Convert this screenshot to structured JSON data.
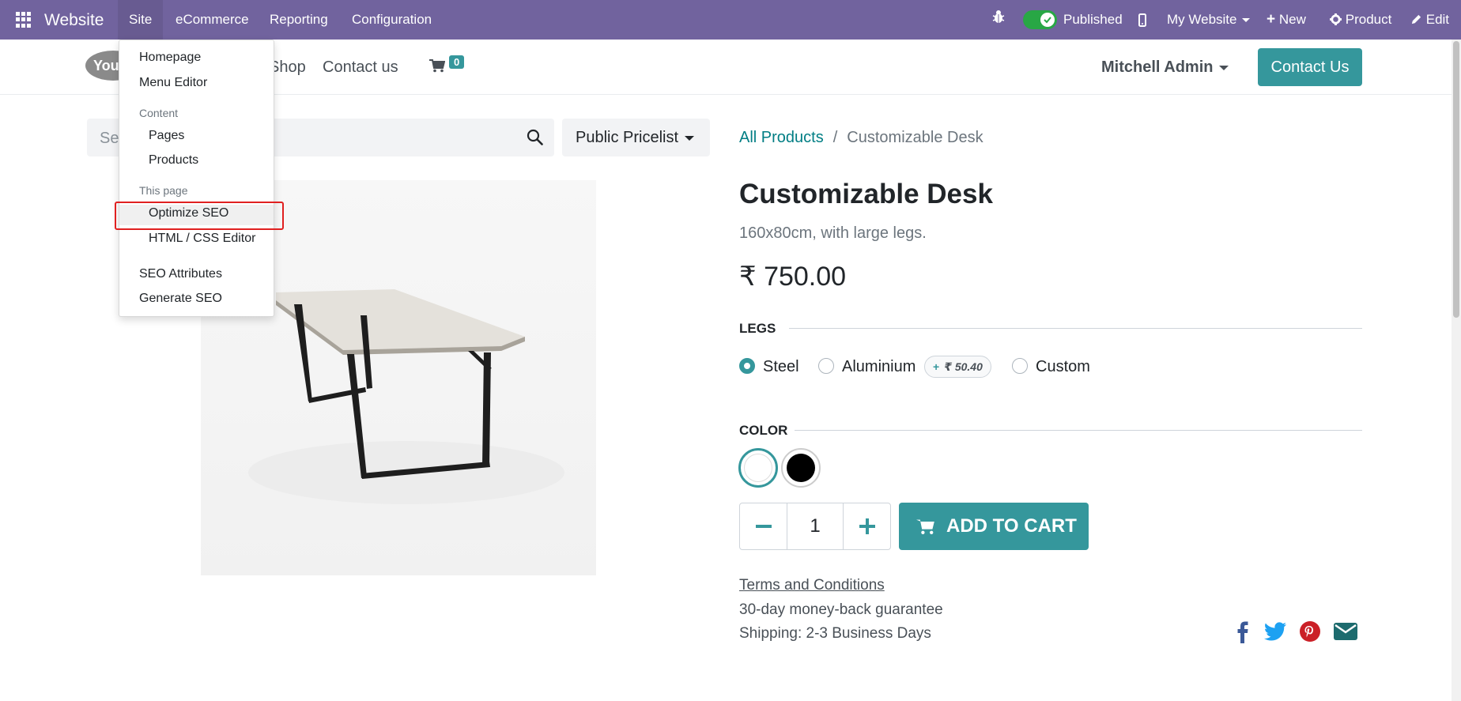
{
  "topbar": {
    "brand": "Website",
    "menus": [
      "Site",
      "eCommerce",
      "Reporting",
      "Configuration"
    ],
    "published_label": "Published",
    "website_selector": "My Website",
    "new_label": "New",
    "product_label": "Product",
    "edit_label": "Edit",
    "bg_color": "#71639e"
  },
  "site_header": {
    "logo_text": "You",
    "nav": [
      "Shop",
      "Contact us"
    ],
    "cart_count": "0",
    "user_name": "Mitchell Admin",
    "contact_button": "Contact Us",
    "accent_color": "#35979c"
  },
  "search": {
    "placeholder": "Se",
    "pricelist": "Public Pricelist"
  },
  "breadcrumb": {
    "parent": "All Products",
    "separator": "/",
    "current": "Customizable Desk"
  },
  "product": {
    "name": "Customizable Desk",
    "description": "160x80cm, with large legs.",
    "price": "₹ 750.00",
    "legs_heading": "LEGS",
    "legs_options": [
      "Steel",
      "Aluminium",
      "Custom"
    ],
    "legs_selected": "Steel",
    "aluminium_extra_sign": "+",
    "aluminium_extra": "₹ 50.40",
    "color_heading": "COLOR",
    "colors": [
      "#ffffff",
      "#000000"
    ],
    "quantity": "1",
    "add_to_cart": "ADD TO CART",
    "terms": "Terms and Conditions",
    "guarantee": "30-day money-back guarantee",
    "shipping": "Shipping: 2-3 Business Days"
  },
  "dropdown": {
    "items": {
      "homepage": "Homepage",
      "menu_editor": "Menu Editor",
      "content_header": "Content",
      "pages": "Pages",
      "products": "Products",
      "this_page_header": "This page",
      "optimize_seo": "Optimize SEO",
      "html_css_editor": "HTML / CSS Editor",
      "seo_attributes": "SEO Attributes",
      "generate_seo": "Generate SEO"
    }
  }
}
